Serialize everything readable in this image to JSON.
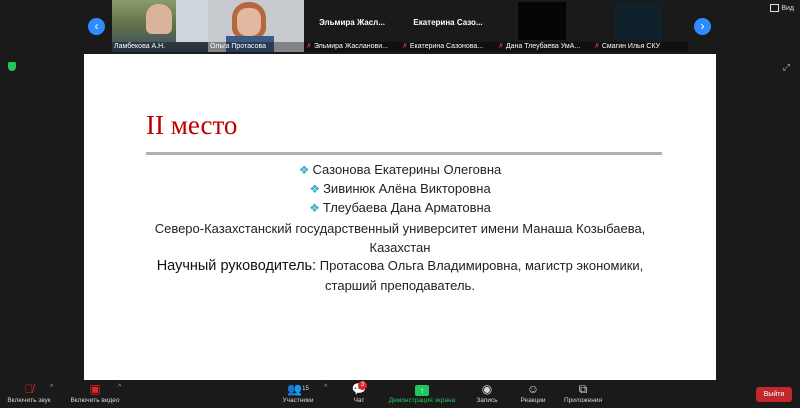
{
  "colors": {
    "accent": "#2d8cff",
    "share_green": "#23c55e",
    "exit_red": "#c1272d",
    "title_red": "#c00000"
  },
  "gallery": {
    "prev_icon": "chevron-left-icon",
    "next_icon": "chevron-right-icon",
    "participants": [
      {
        "label": "Ламбекова А.Н.",
        "muted": false,
        "video": true
      },
      {
        "label": "Ольга Протасова",
        "muted": false,
        "video": true
      },
      {
        "name": "Эльмира Жасл...",
        "label": "Эльмира Жасланови...",
        "muted": true,
        "video": false
      },
      {
        "name": "Екатерина Сазо...",
        "label": "Екатерина Сазонова...",
        "muted": true,
        "video": false
      },
      {
        "label": "Дана Тлеубаева УмА...",
        "muted": true,
        "video": false
      },
      {
        "label": "Смагин Илья СКУ",
        "muted": true,
        "video": false
      }
    ],
    "view_label": "Вид"
  },
  "slide": {
    "title": "II место",
    "names": [
      "Сазонова Екатерины Олеговна",
      "Зивинюк Алёна Викторовна",
      "Тлеубаева Дана Арматовна"
    ],
    "university": "Северо-Казахстанский государственный университет имени Манаша Козыбаева,",
    "country": "Казахстан",
    "advisor_label": "Научный руководитель:",
    "advisor_text": "Протасова Ольга Владимировна, магистр экономики,",
    "advisor_position": "старший преподаватель."
  },
  "toolbar": {
    "audio": "Включить звук",
    "video": "Включить видео",
    "participants": "Участники",
    "participants_count": "15",
    "chat": "Чат",
    "chat_badge": "3",
    "share": "Демонстрация экрана",
    "record": "Запись",
    "reactions": "Реакции",
    "apps": "Приложения",
    "exit": "Выйти"
  }
}
